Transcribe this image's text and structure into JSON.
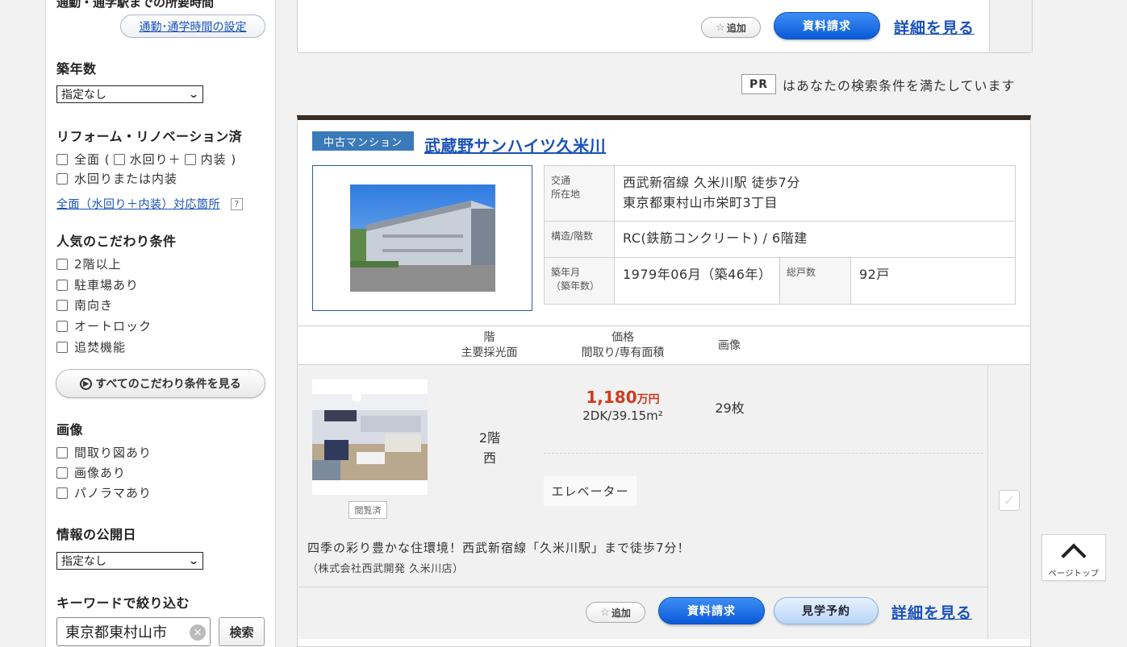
{
  "sidebar": {
    "cut_heading": "通勤・通学駅までの所要時間",
    "commute_link": "通勤･通学時間の設定",
    "age": {
      "heading": "築年数",
      "selected": "指定なし"
    },
    "reform": {
      "heading": "リフォーム・リノベーション済",
      "full_label": "全面 (",
      "water_label": "水回り＋",
      "interior_label": "内装 )",
      "water_or_interior": "水回りまたは内装",
      "help_link": "全面（水回り＋内装）対応箇所",
      "help_icon": "?"
    },
    "popular": {
      "heading": "人気のこだわり条件",
      "items": [
        "2階以上",
        "駐車場あり",
        "南向き",
        "オートロック",
        "追焚機能"
      ],
      "all_button": "すべてのこだわり条件を見る"
    },
    "images": {
      "heading": "画像",
      "items": [
        "間取り図あり",
        "画像あり",
        "パノラマあり"
      ]
    },
    "published": {
      "heading": "情報の公開日",
      "selected": "指定なし"
    },
    "keyword": {
      "heading": "キーワードで絞り込む",
      "value": "東京都東村山市",
      "search_button": "検索"
    }
  },
  "prev_card": {
    "add_label": "追加",
    "request_label": "資料請求",
    "detail_label": "詳細を見る"
  },
  "pr_note": {
    "badge": "PR",
    "text": "はあなたの検索条件を満たしています"
  },
  "listing": {
    "category": "中古マンション",
    "title": "武蔵野サンハイツ久米川",
    "labels": {
      "access_1": "交通",
      "access_2": "所在地",
      "structure": "構造/階数",
      "built_1": "築年月",
      "built_2": "（築年数）",
      "units": "総戸数"
    },
    "access": "西武新宿線 久米川駅 徒歩7分",
    "address": "東京都東村山市栄町3丁目",
    "structure": "RC(鉄筋コンクリート) / 6階建",
    "built": "1979年06月（築46年）",
    "units": "92戸",
    "columns": {
      "floor_1": "階",
      "floor_2": "主要採光面",
      "price_1": "価格",
      "price_2": "間取り/専有面積",
      "image": "画像"
    },
    "unit": {
      "viewed": "閲覧済",
      "floor": "2階",
      "direction": "西",
      "price": "1,180",
      "price_unit": "万円",
      "layout": "2DK/39.15m²",
      "image_count": "29枚",
      "feature": "エレベーター",
      "description": "四季の彩り豊かな住環境！西武新宿線「久米川駅」まで徒歩7分！",
      "company": "（株式会社西武開発 久米川店）"
    },
    "buttons": {
      "add": "追加",
      "request": "資料請求",
      "visit": "見学予約",
      "detail": "詳細を見る"
    }
  },
  "page_top": "ページトップ"
}
